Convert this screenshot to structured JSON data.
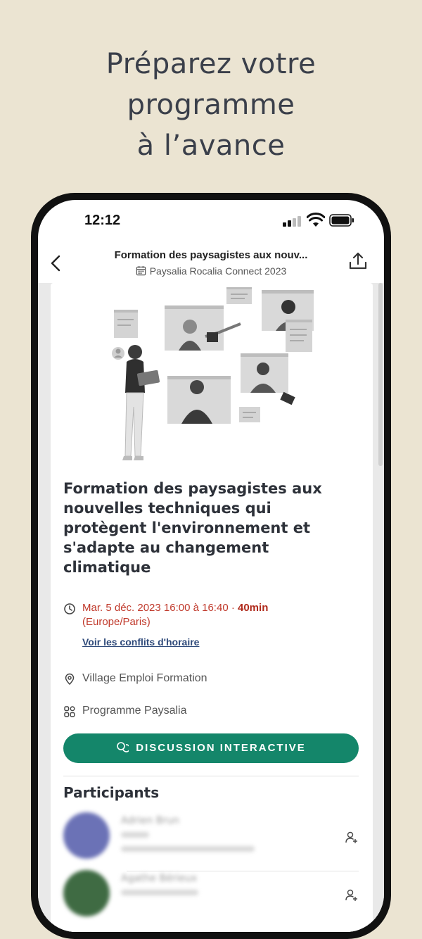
{
  "headline": [
    "Préparez votre",
    "programme",
    "à l’avance"
  ],
  "status_bar": {
    "time": "12:12"
  },
  "nav": {
    "title": "Formation des paysagistes aux nouv...",
    "subtitle": "Paysalia Rocalia Connect 2023"
  },
  "event": {
    "title_lines": [
      "Formation des paysagistes aux",
      "nouvelles techniques qui",
      "protègent l'environnement et",
      "s'adapte au changement",
      "climatique"
    ],
    "datetime": "Mar. 5 déc. 2023 16:00 à 16:40 · ",
    "duration": "40min",
    "timezone": "(Europe/Paris)",
    "conflicts_link": "Voir les conflits d'horaire",
    "location": "Village Emploi Formation",
    "program": "Programme Paysalia",
    "cta_label": "DISCUSSION INTERACTIVE"
  },
  "participants": {
    "heading": "Participants",
    "items": [
      {
        "name": "Adrien Brun",
        "avatar_color": "#6b72b6"
      },
      {
        "name": "Agathe Bérieux",
        "avatar_color": "#3f6b43"
      }
    ]
  },
  "colors": {
    "background": "#ebe4d2",
    "accent": "#14866a",
    "time_red": "#c0392b",
    "link_blue": "#2f4a7a"
  }
}
